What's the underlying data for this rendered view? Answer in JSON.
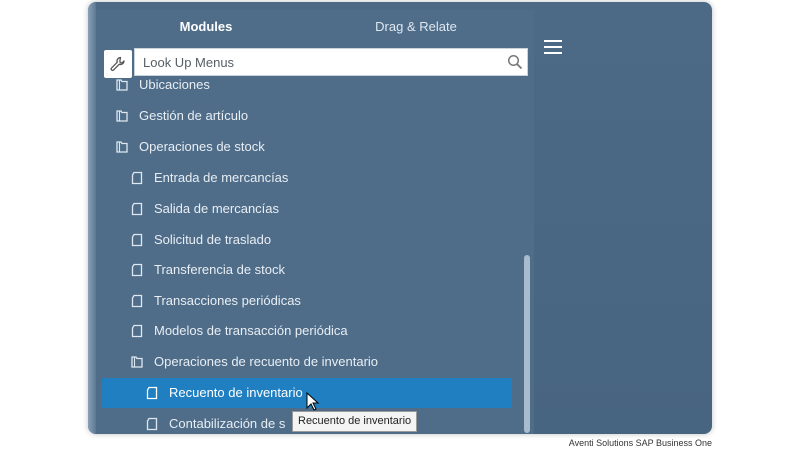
{
  "tabs": [
    {
      "label": "Modules",
      "active": true
    },
    {
      "label": "Drag & Relate",
      "active": false
    }
  ],
  "search": {
    "placeholder": "Look Up Menus"
  },
  "menu_items": [
    {
      "label": "Ubicaciones",
      "icon": "folder-icon"
    },
    {
      "label": "Gestión de artículo",
      "icon": "folder-icon"
    },
    {
      "label": "Operaciones de stock",
      "icon": "folder-icon"
    },
    {
      "label": "Entrada de mercancías",
      "icon": "document-icon"
    },
    {
      "label": "Salida de mercancías",
      "icon": "document-icon"
    },
    {
      "label": "Solicitud de traslado",
      "icon": "document-icon"
    },
    {
      "label": "Transferencia de stock",
      "icon": "document-icon"
    },
    {
      "label": "Transacciones periódicas",
      "icon": "document-icon"
    },
    {
      "label": "Modelos de transacción periódica",
      "icon": "document-icon"
    },
    {
      "label": "Operaciones de recuento de inventario",
      "icon": "folder-icon"
    },
    {
      "label": "Recuento de inventario",
      "icon": "document-icon",
      "selected": true
    },
    {
      "label": "Contabilización de s",
      "icon": "document-icon"
    }
  ],
  "tooltip": {
    "text": "Recuento de inventario"
  },
  "watermark": "Aventi Solutions SAP Business One",
  "colors": {
    "panel": "#4f6d89",
    "selected": "#1f7fc1"
  }
}
